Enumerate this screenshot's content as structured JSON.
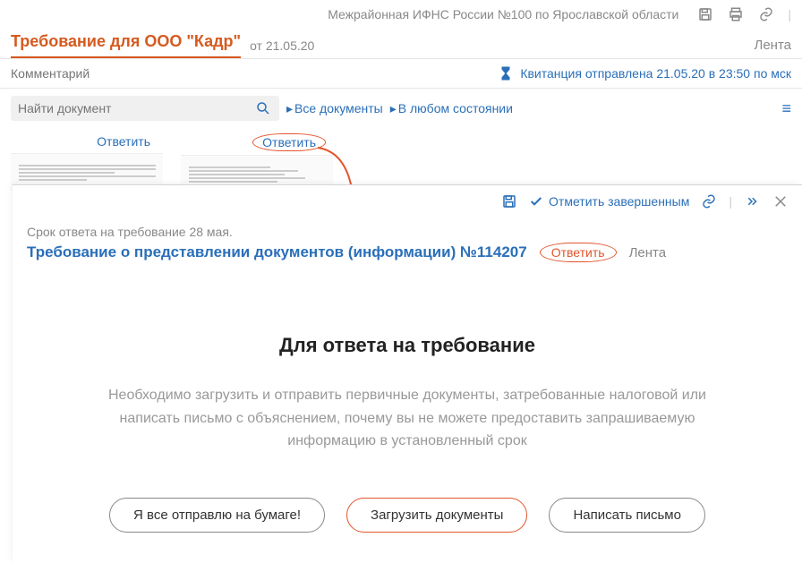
{
  "topbar": {
    "org": "Межрайонная ИФНС России №100 по Ярославской области"
  },
  "header": {
    "title": "Требование для ООО \"Кадр\"",
    "date": "от 21.05.20",
    "lenta": "Лента"
  },
  "comment": {
    "placeholder": "Комментарий",
    "status": "Квитанция отправлена 21.05.20 в 23:50 по мск"
  },
  "filter": {
    "search_placeholder": "Найти документ",
    "all_docs": "Все документы",
    "any_state": "В любом состоянии"
  },
  "thumbs": {
    "reply": "Ответить"
  },
  "panel": {
    "mark_complete": "Отметить завершенным",
    "deadline": "Срок ответа на требование 28 мая.",
    "title": "Требование о представлении документов (информации) №114207",
    "reply": "Ответить",
    "lenta": "Лента",
    "instr_title": "Для ответа на требование",
    "instr_body": "Необходимо загрузить и отправить первичные документы, затребованные налоговой или написать письмо с объяснением, почему вы не можете предоставить запрашиваемую информацию в установленный срок",
    "btn_paper": "Я все отправлю на бумаге!",
    "btn_upload": "Загрузить документы",
    "btn_letter": "Написать письмо"
  }
}
